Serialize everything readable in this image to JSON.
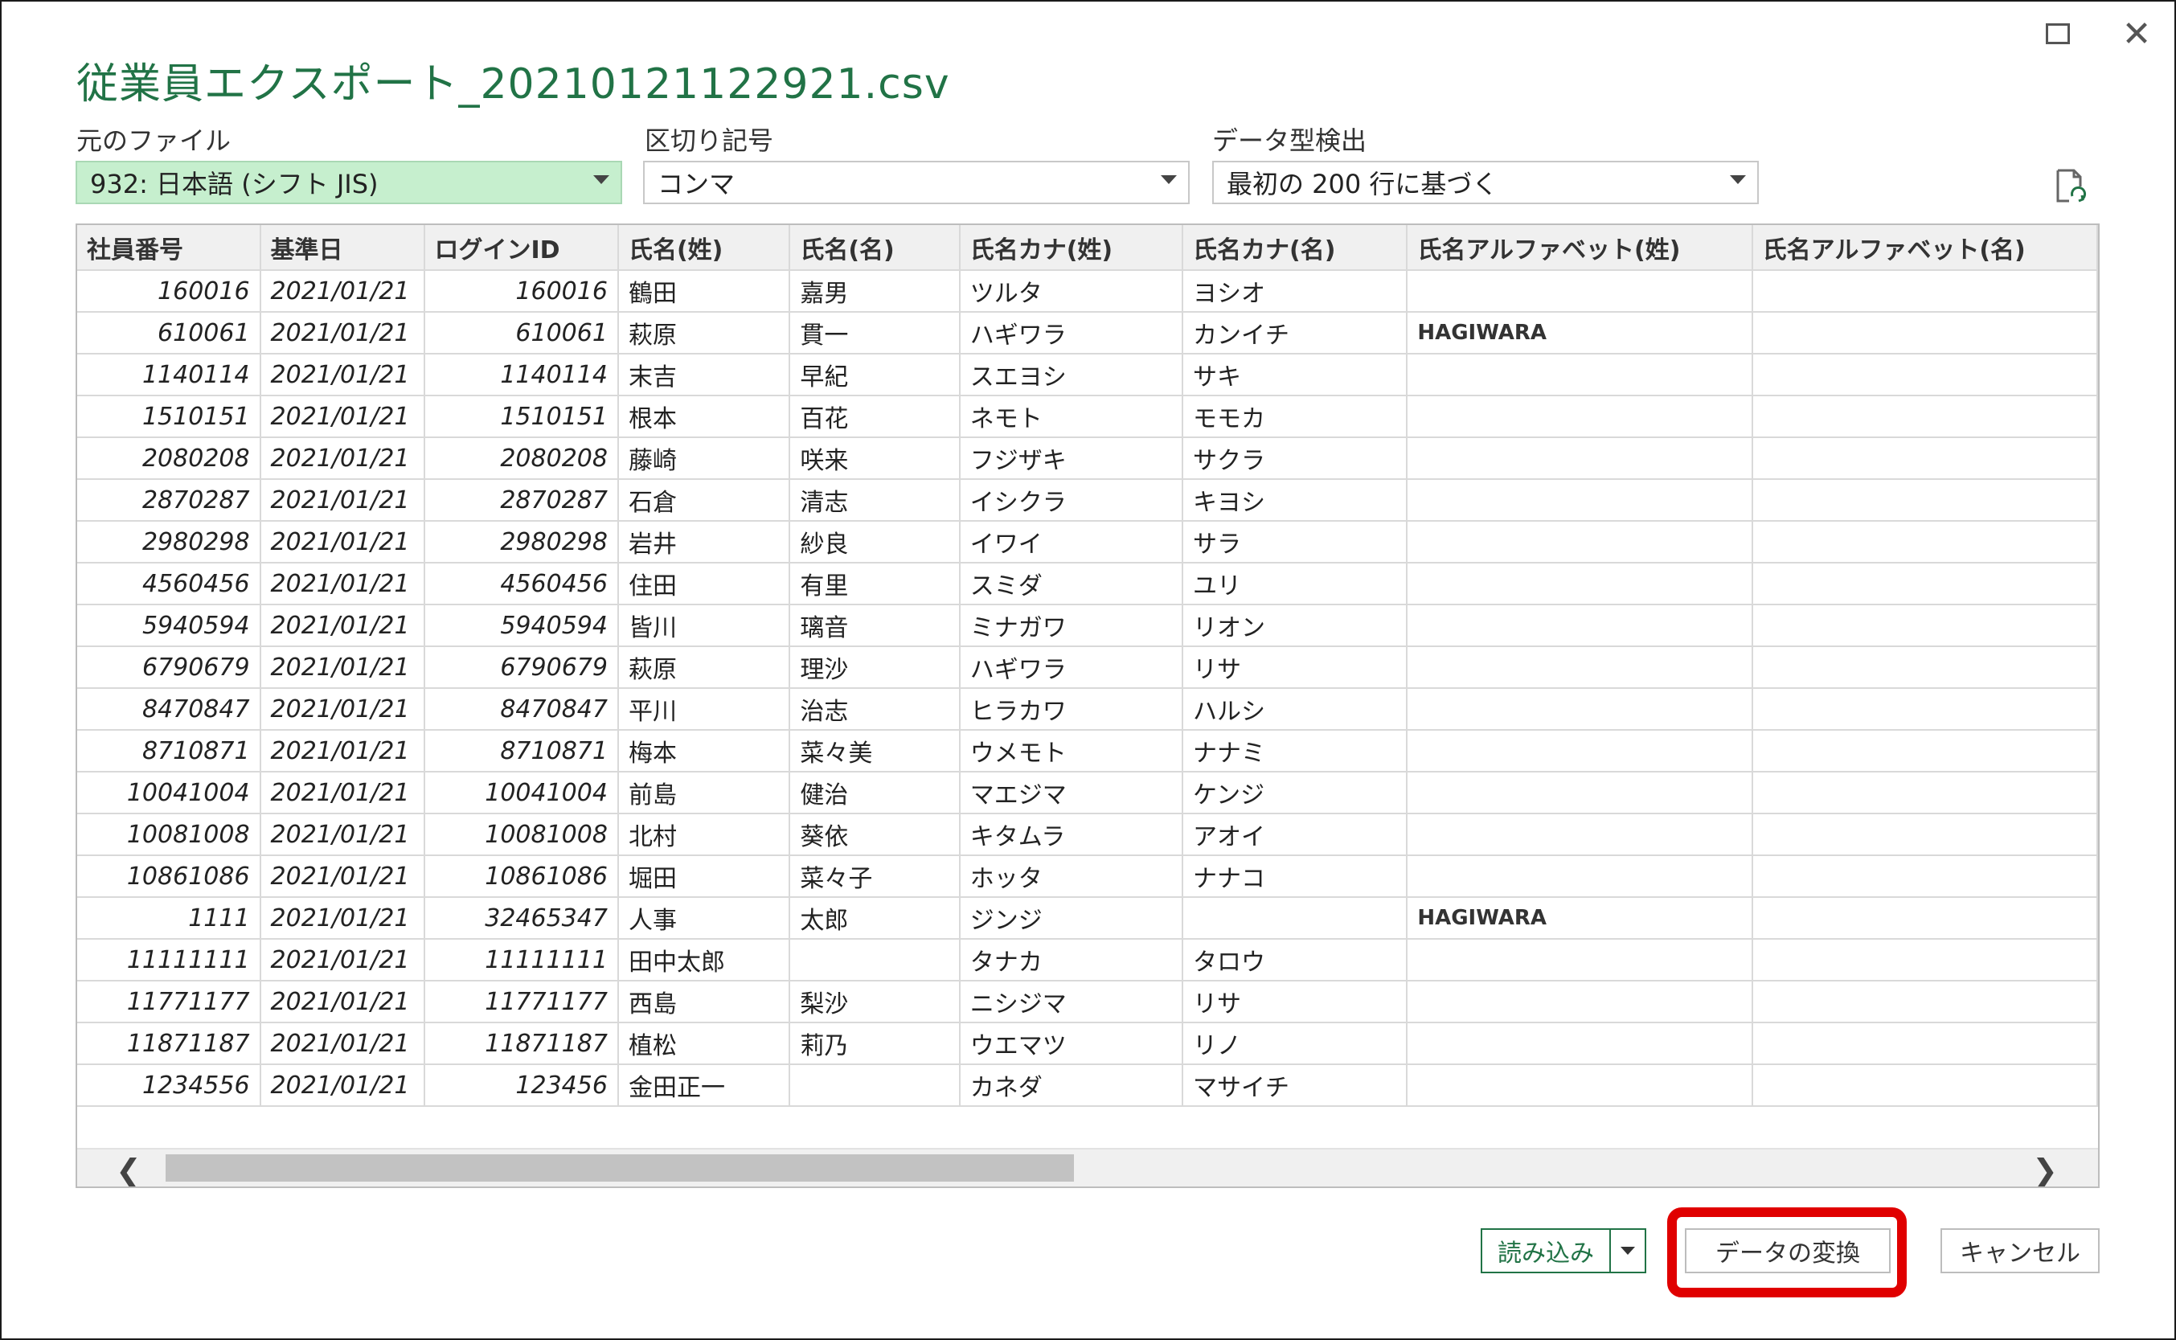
{
  "window": {
    "title": "従業員エクスポート_20210121122921.csv"
  },
  "options": {
    "file_origin_label": "元のファイル",
    "file_origin_value": "932: 日本語 (シフト JIS)",
    "delimiter_label": "区切り記号",
    "delimiter_value": "コンマ",
    "detection_label": "データ型検出",
    "detection_value": "最初の 200 行に基づく"
  },
  "table": {
    "columns": [
      "社員番号",
      "基準日",
      "ログインID",
      "氏名(姓)",
      "氏名(名)",
      "氏名カナ(姓)",
      "氏名カナ(名)",
      "氏名アルファベット(姓)",
      "氏名アルファベット(名)"
    ],
    "rows": [
      [
        "160016",
        "2021/01/21",
        "160016",
        "鶴田",
        "嘉男",
        "ツルタ",
        "ヨシオ",
        "",
        ""
      ],
      [
        "610061",
        "2021/01/21",
        "610061",
        "萩原",
        "貫一",
        "ハギワラ",
        "カンイチ",
        "HAGIWARA",
        ""
      ],
      [
        "1140114",
        "2021/01/21",
        "1140114",
        "末吉",
        "早紀",
        "スエヨシ",
        "サキ",
        "",
        ""
      ],
      [
        "1510151",
        "2021/01/21",
        "1510151",
        "根本",
        "百花",
        "ネモト",
        "モモカ",
        "",
        ""
      ],
      [
        "2080208",
        "2021/01/21",
        "2080208",
        "藤崎",
        "咲来",
        "フジザキ",
        "サクラ",
        "",
        ""
      ],
      [
        "2870287",
        "2021/01/21",
        "2870287",
        "石倉",
        "清志",
        "イシクラ",
        "キヨシ",
        "",
        ""
      ],
      [
        "2980298",
        "2021/01/21",
        "2980298",
        "岩井",
        "紗良",
        "イワイ",
        "サラ",
        "",
        ""
      ],
      [
        "4560456",
        "2021/01/21",
        "4560456",
        "住田",
        "有里",
        "スミダ",
        "ユリ",
        "",
        ""
      ],
      [
        "5940594",
        "2021/01/21",
        "5940594",
        "皆川",
        "璃音",
        "ミナガワ",
        "リオン",
        "",
        ""
      ],
      [
        "6790679",
        "2021/01/21",
        "6790679",
        "萩原",
        "理沙",
        "ハギワラ",
        "リサ",
        "",
        ""
      ],
      [
        "8470847",
        "2021/01/21",
        "8470847",
        "平川",
        "治志",
        "ヒラカワ",
        "ハルシ",
        "",
        ""
      ],
      [
        "8710871",
        "2021/01/21",
        "8710871",
        "梅本",
        "菜々美",
        "ウメモト",
        "ナナミ",
        "",
        ""
      ],
      [
        "10041004",
        "2021/01/21",
        "10041004",
        "前島",
        "健治",
        "マエジマ",
        "ケンジ",
        "",
        ""
      ],
      [
        "10081008",
        "2021/01/21",
        "10081008",
        "北村",
        "葵依",
        "キタムラ",
        "アオイ",
        "",
        ""
      ],
      [
        "10861086",
        "2021/01/21",
        "10861086",
        "堀田",
        "菜々子",
        "ホッタ",
        "ナナコ",
        "",
        ""
      ],
      [
        "1111",
        "2021/01/21",
        "32465347",
        "人事",
        "太郎",
        "ジンジ",
        "",
        "HAGIWARA",
        ""
      ],
      [
        "11111111",
        "2021/01/21",
        "11111111",
        "田中太郎",
        "",
        "タナカ",
        "タロウ",
        "",
        ""
      ],
      [
        "11771177",
        "2021/01/21",
        "11771177",
        "西島",
        "梨沙",
        "ニシジマ",
        "リサ",
        "",
        ""
      ],
      [
        "11871187",
        "2021/01/21",
        "11871187",
        "植松",
        "莉乃",
        "ウエマツ",
        "リノ",
        "",
        ""
      ],
      [
        "1234556",
        "2021/01/21",
        "123456",
        "金田正一",
        "",
        "カネダ",
        "マサイチ",
        "",
        ""
      ]
    ]
  },
  "footer": {
    "load_label": "読み込み",
    "transform_label": "データの変換",
    "cancel_label": "キャンセル"
  },
  "colors": {
    "title": "#217346",
    "highlight": "#e00000",
    "selected_dropdown": "#c6efce"
  }
}
